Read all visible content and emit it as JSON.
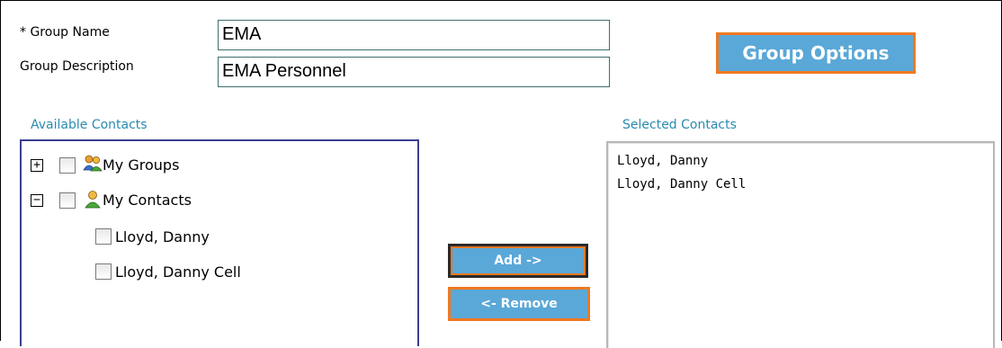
{
  "form": {
    "group_name_label": "* Group Name",
    "group_name_value": "EMA",
    "group_desc_label": "Group Description",
    "group_desc_value": "EMA Personnel",
    "group_options_button": "Group Options"
  },
  "available": {
    "title": "Available Contacts",
    "nodes": [
      {
        "label": "My Groups",
        "expander": "+",
        "icon": "groups-icon"
      },
      {
        "label": "My Contacts",
        "expander": "−",
        "icon": "contact-icon"
      }
    ],
    "children": [
      "Lloyd, Danny",
      "Lloyd, Danny Cell"
    ]
  },
  "actions": {
    "add_label": "Add ->",
    "remove_label": "<- Remove"
  },
  "selected": {
    "title": "Selected Contacts",
    "items": [
      "Lloyd, Danny",
      "Lloyd, Danny Cell"
    ]
  },
  "colors": {
    "button_bg": "#5aa8d8",
    "button_border": "#f07820",
    "section_title": "#2a8bb0"
  }
}
